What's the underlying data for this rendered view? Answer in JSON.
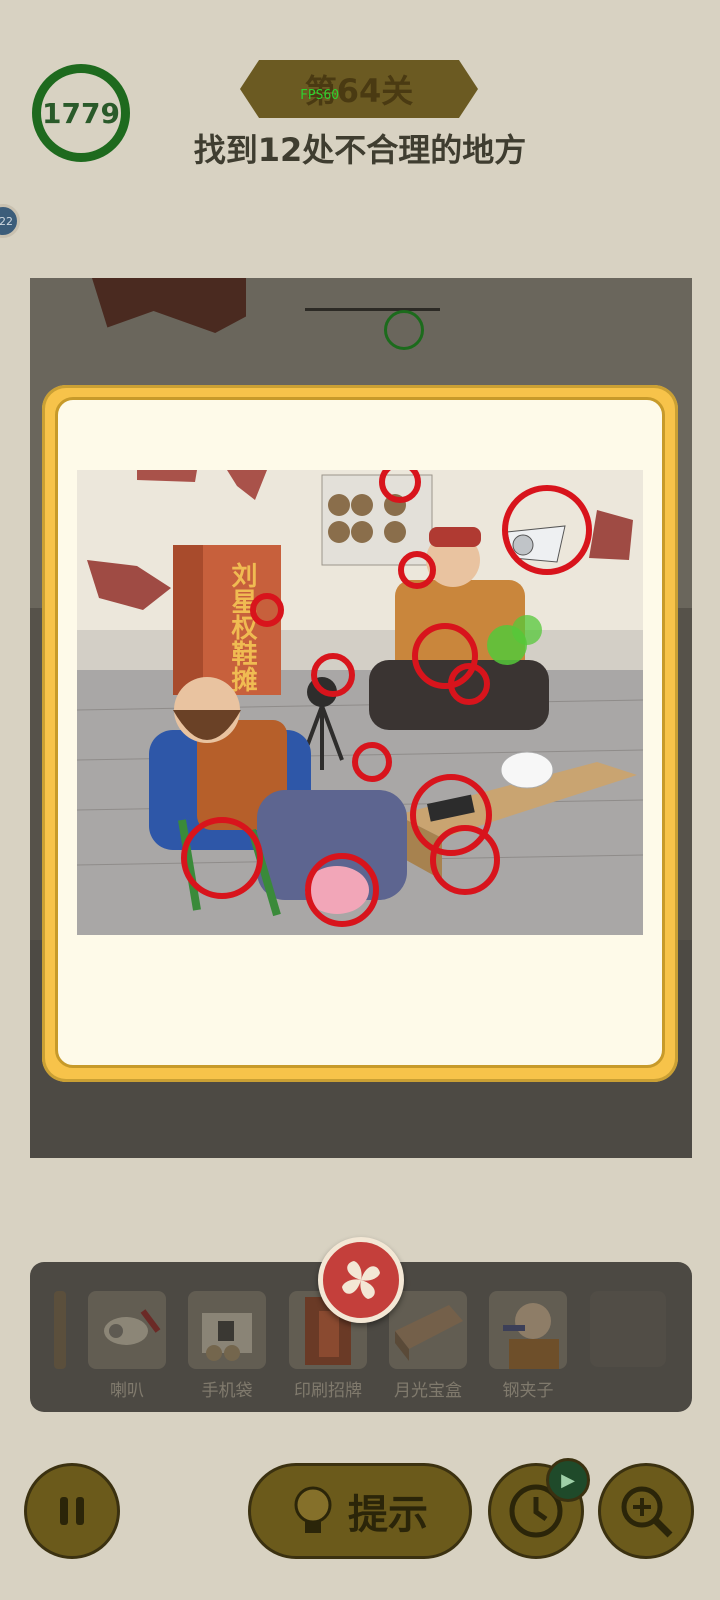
{
  "hud": {
    "timer_value": "1779",
    "level_label": "第64关",
    "fps_label": "FPS60",
    "objective": "找到12处不合理的地方",
    "side_badge": "22"
  },
  "modal": {
    "sign_text": "刘星权鞋摊",
    "close_icon": "x-cross-icon",
    "found_marks_count": 12
  },
  "found_items": [
    {
      "label": "喇叭"
    },
    {
      "label": "手机袋"
    },
    {
      "label": "印刷招牌"
    },
    {
      "label": "月光宝盒"
    },
    {
      "label": "钢夹子"
    }
  ],
  "controls": {
    "pause_icon": "pause-icon",
    "hint_label": "提示",
    "hint_icon": "lightbulb-icon",
    "clock_icon": "clock-icon",
    "video_icon": "video-ad-icon",
    "zoom_icon": "zoom-in-icon"
  },
  "colors": {
    "modal_border": "#f7c34a",
    "modal_fill": "#fefae9",
    "close_button": "#c43f3b",
    "found_mark": "#d8141c",
    "timer_ring": "#1e6a1e"
  }
}
